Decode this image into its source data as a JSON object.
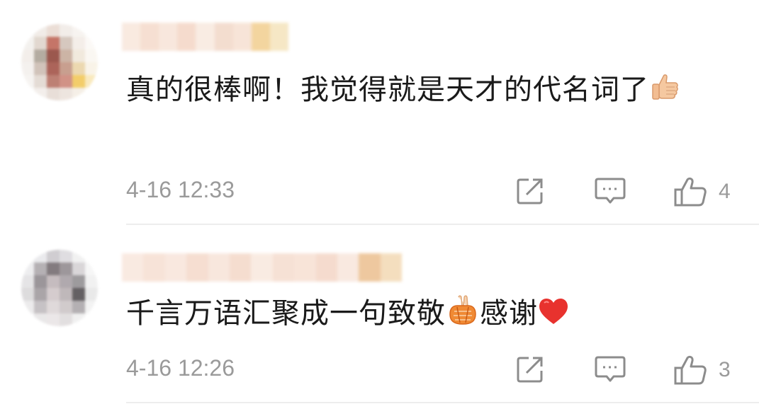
{
  "comments": [
    {
      "text_main": "真的很棒啊！我觉得就是天才的代名词了",
      "emoji": "thumbs-up",
      "time": "4-16 12:33",
      "likes": "4"
    },
    {
      "text_main": "千言万语汇聚成一句致敬",
      "text_mid": "感谢",
      "emoji_a": "folded-hands",
      "emoji_b": "red-heart",
      "time": "4-16 12:26",
      "likes": "3"
    }
  ],
  "colors": {
    "text": "#1a1a1a",
    "meta": "#9a9a9a",
    "divider": "#ededed",
    "heart": "#e8322e"
  },
  "icons": [
    "share-icon",
    "comment-icon",
    "like-icon"
  ]
}
